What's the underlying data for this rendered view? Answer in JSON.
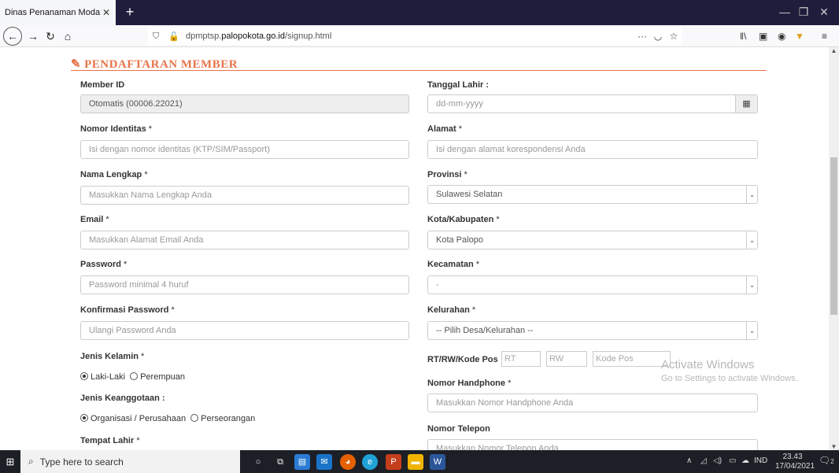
{
  "browser": {
    "tab_title": "Dinas Penanaman Modal dan Pelay",
    "url_domain": "palopokota.go.id",
    "url_prefix": "dpmptsp.",
    "url_path": "/signup.html",
    "url_more": "···"
  },
  "page": {
    "heading": "PENDAFTARAN MEMBER",
    "left": {
      "member_id_label": "Member ID",
      "member_id_value": "Otomatis (00006.22021)",
      "nomor_identitas_label": "Nomor Identitas",
      "nomor_identitas_placeholder": "Isi dengan nomor identitas (KTP/SIM/Passport)",
      "nama_label": "Nama Lengkap",
      "nama_placeholder": "Masukkan Nama Lengkap Anda",
      "email_label": "Email",
      "email_placeholder": "Masukkan Alamat Email Anda",
      "password_label": "Password",
      "password_placeholder": "Password minimal 4 huruf",
      "konfirmasi_label": "Konfirmasi Password",
      "konfirmasi_placeholder": "Ulangi Password Anda",
      "jenis_kelamin_label": "Jenis Kelamin",
      "jk_option1": "Laki-Laki",
      "jk_option2": "Perempuan",
      "keanggotaan_label": "Jenis Keanggotaan :",
      "ka_option1": "Organisasi / Perusahaan",
      "ka_option2": "Perseorangan",
      "tempat_lahir_label": "Tempat Lahir"
    },
    "right": {
      "tanggal_label": "Tanggal Lahir :",
      "tanggal_placeholder": "dd-mm-yyyy",
      "alamat_label": "Alamat",
      "alamat_placeholder": "Isi dengan alamat korespondensi Anda",
      "provinsi_label": "Provinsi",
      "provinsi_value": "Sulawesi Selatan",
      "kota_label": "Kota/Kabupaten",
      "kota_value": "Kota Palopo",
      "kecamatan_label": "Kecamatan",
      "kecamatan_value": "-",
      "kelurahan_label": "Kelurahan",
      "kelurahan_value": "-- Pilih Desa/Kelurahan --",
      "rtrw_label": "RT/RW/Kode Pos",
      "rt_placeholder": "RT",
      "rw_placeholder": "RW",
      "kodepos_placeholder": "Kode Pos",
      "hp_label": "Nomor Handphone",
      "hp_placeholder": "Masukkan Nomor Handphone Anda",
      "telepon_label": "Nomor Telepon",
      "telepon_placeholder": "Masukkan Nomor Telepon Anda"
    },
    "required_mark": "*"
  },
  "watermark": {
    "line1": "Activate Windows",
    "line2": "Go to Settings to activate Windows."
  },
  "taskbar": {
    "search_placeholder": "Type here to search",
    "lang": "IND",
    "time": "23.43",
    "date": "17/04/2021",
    "notif_count": "2"
  },
  "colors": {
    "accent": "#e8734a",
    "tabbar": "#1e1e3c",
    "taskbar": "#1c1f26"
  }
}
